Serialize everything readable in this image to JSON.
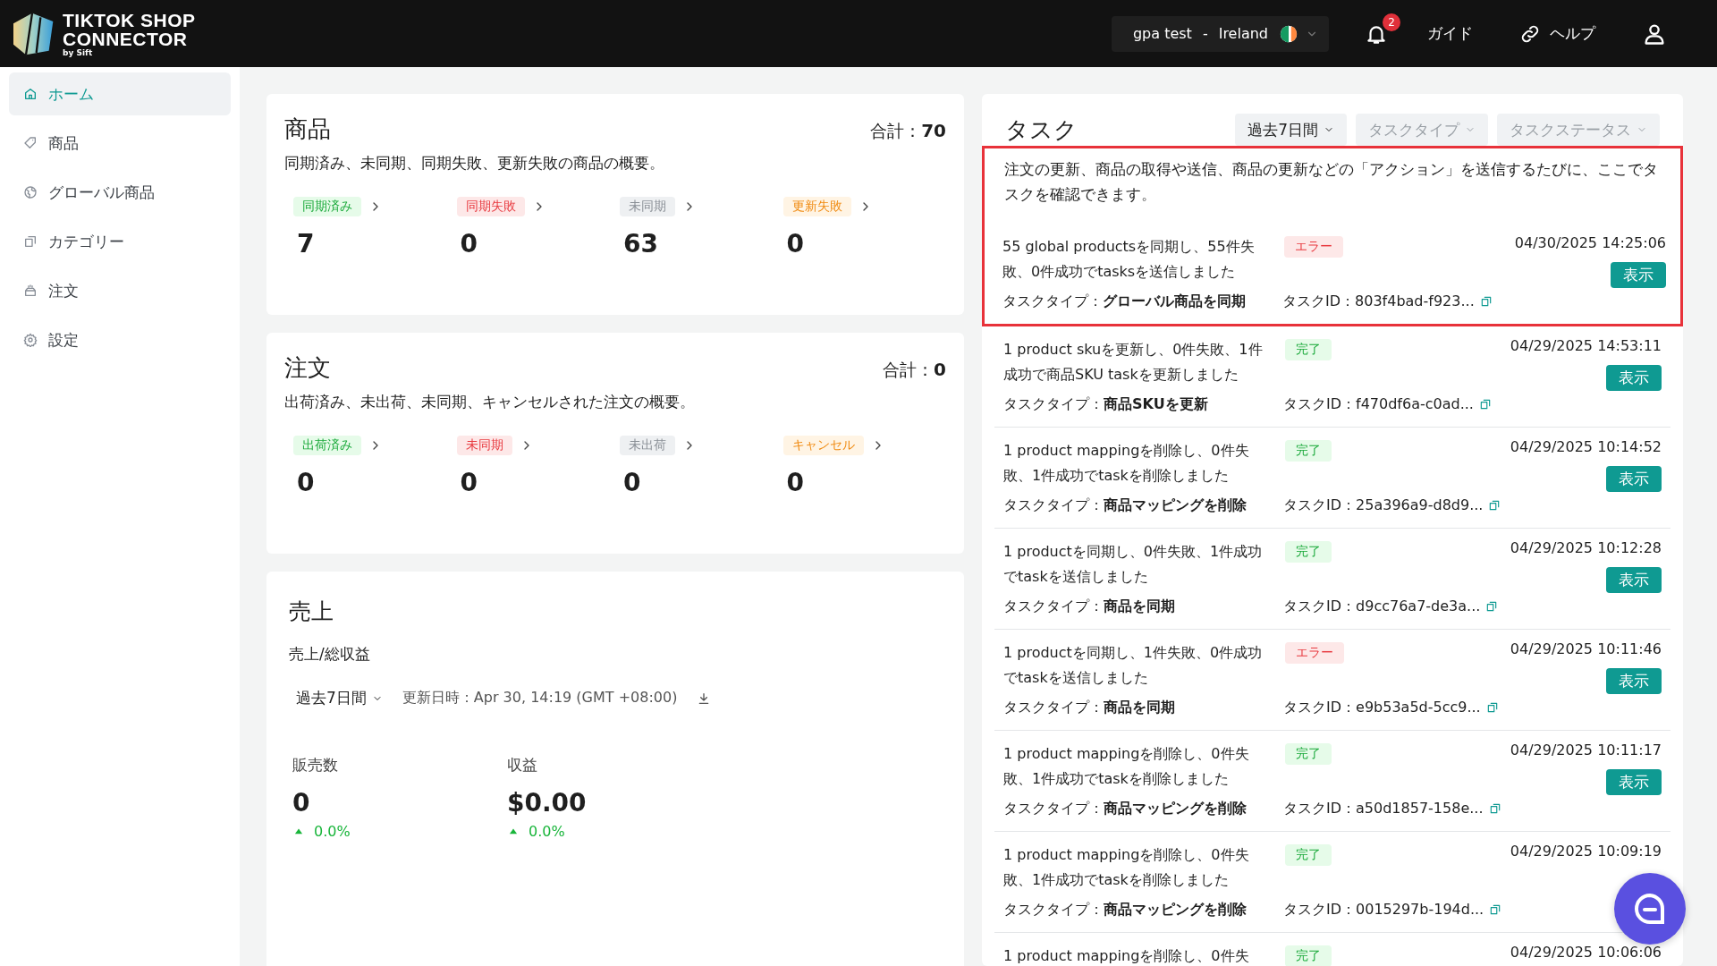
{
  "header": {
    "logo": {
      "line1": "TIKTOK SHOP",
      "line2": "CONNECTOR",
      "byline": "by Sift"
    },
    "store": {
      "name": "gpa test",
      "separator": "-",
      "country": "Ireland"
    },
    "notifications": {
      "count": "2"
    },
    "guide": "ガイド",
    "help": "ヘルプ"
  },
  "sidebar": {
    "items": [
      {
        "label": "ホーム",
        "selected": true
      },
      {
        "label": "商品",
        "selected": false
      },
      {
        "label": "グローバル商品",
        "selected": false
      },
      {
        "label": "カテゴリー",
        "selected": false
      },
      {
        "label": "注文",
        "selected": false
      },
      {
        "label": "設定",
        "selected": false
      }
    ]
  },
  "products": {
    "title": "商品",
    "total_label": "合計：",
    "total": "70",
    "subtitle": "同期済み、未同期、同期失敗、更新失敗の商品の概要。",
    "stats": [
      {
        "label": "同期済み",
        "kind": "success",
        "value": "7"
      },
      {
        "label": "同期失敗",
        "kind": "error",
        "value": "0"
      },
      {
        "label": "未同期",
        "kind": "neutral",
        "value": "63"
      },
      {
        "label": "更新失敗",
        "kind": "warning",
        "value": "0"
      }
    ]
  },
  "orders": {
    "title": "注文",
    "total_label": "合計：",
    "total": "0",
    "subtitle": "出荷済み、未出荷、未同期、キャンセルされた注文の概要。",
    "stats": [
      {
        "label": "出荷済み",
        "kind": "success",
        "value": "0"
      },
      {
        "label": "未同期",
        "kind": "error",
        "value": "0"
      },
      {
        "label": "未出荷",
        "kind": "neutral",
        "value": "0"
      },
      {
        "label": "キャンセル",
        "kind": "warning",
        "value": "0"
      }
    ]
  },
  "sales": {
    "title": "売上",
    "subtitle": "売上/総収益",
    "period": "過去7日間",
    "updated": "更新日時：Apr 30, 14:19 (GMT +08:00)",
    "metrics": [
      {
        "label": "販売数",
        "value": "0",
        "change": "0.0%"
      },
      {
        "label": "収益",
        "value": "$0.00",
        "change": "0.0%"
      }
    ]
  },
  "tasks": {
    "title": "タスク",
    "filters": [
      {
        "value": "過去7日間"
      },
      {
        "placeholder": "タスクタイプ"
      },
      {
        "placeholder": "タスクステータス"
      }
    ],
    "highlighted": true,
    "note": "注文の更新、商品の取得や送信、商品の更新などの「アクション」を送信するたびに、ここでタスクを確認できます。",
    "items": [
      {
        "description": "55 global productsを同期し、55件失敗、0件成功でtasksを送信しました",
        "status": "エラー",
        "kind": "error",
        "date": "04/30/2025 14:25:06",
        "type_label": "タスクタイプ：",
        "type": "グローバル商品を同期",
        "id_label": "タスクID：",
        "id": "803f4bad-f923...",
        "button": "表示"
      },
      {
        "description": "1 product skuを更新し、0件失敗、1件成功で商品SKU taskを更新しました",
        "status": "完了",
        "kind": "done",
        "date": "04/29/2025 14:53:11",
        "type_label": "タスクタイプ：",
        "type": "商品SKUを更新",
        "id_label": "タスクID：",
        "id": "f470df6a-c0ad...",
        "button": "表示"
      },
      {
        "description": "1 product mappingを削除し、0件失敗、1件成功でtaskを削除しました",
        "status": "完了",
        "kind": "done",
        "date": "04/29/2025 10:14:52",
        "type_label": "タスクタイプ：",
        "type": "商品マッピングを削除",
        "id_label": "タスクID：",
        "id": "25a396a9-d8d9...",
        "button": "表示"
      },
      {
        "description": "1 productを同期し、0件失敗、1件成功でtaskを送信しました",
        "status": "完了",
        "kind": "done",
        "date": "04/29/2025 10:12:28",
        "type_label": "タスクタイプ：",
        "type": "商品を同期",
        "id_label": "タスクID：",
        "id": "d9cc76a7-de3a...",
        "button": "表示"
      },
      {
        "description": "1 productを同期し、1件失敗、0件成功でtaskを送信しました",
        "status": "エラー",
        "kind": "error",
        "date": "04/29/2025 10:11:46",
        "type_label": "タスクタイプ：",
        "type": "商品を同期",
        "id_label": "タスクID：",
        "id": "e9b53a5d-5cc9...",
        "button": "表示"
      },
      {
        "description": "1 product mappingを削除し、0件失敗、1件成功でtaskを削除しました",
        "status": "完了",
        "kind": "done",
        "date": "04/29/2025 10:11:17",
        "type_label": "タスクタイプ：",
        "type": "商品マッピングを削除",
        "id_label": "タスクID：",
        "id": "a50d1857-158e...",
        "button": "表示"
      },
      {
        "description": "1 product mappingを削除し、0件失敗、1件成功でtaskを削除しました",
        "status": "完了",
        "kind": "done",
        "date": "04/29/2025 10:09:19",
        "type_label": "タスクタイプ：",
        "type": "商品マッピングを削除",
        "id_label": "タスクID：",
        "id": "0015297b-194d..."
      },
      {
        "description": "1 product mappingを削除し、0件失",
        "status": "完了",
        "kind": "done",
        "date": "04/29/2025 10:06:06"
      }
    ]
  }
}
